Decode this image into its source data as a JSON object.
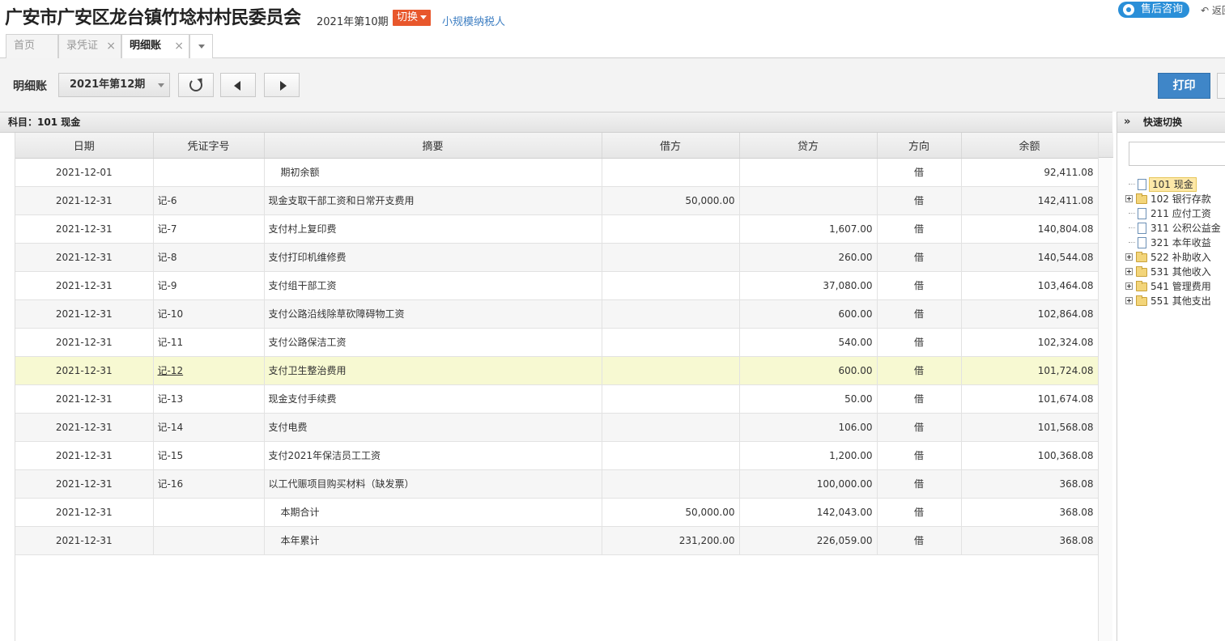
{
  "header": {
    "org_name": "广安市广安区龙台镇竹埝村村民委员会",
    "current_period": "2021年第10期",
    "switch_label": "切换",
    "taxpayer_type": "小规模纳税人",
    "consult_label": "售后咨询",
    "back_label": "↶ 返回"
  },
  "tabs": [
    {
      "label": "首页",
      "closable": false
    },
    {
      "label": "录凭证",
      "closable": true
    },
    {
      "label": "明细账",
      "closable": true,
      "active": true
    }
  ],
  "toolbar": {
    "title": "明细账",
    "period_value": "2021年第12期",
    "print_label": "打印"
  },
  "subject_bar": {
    "text": "科目：101  现金"
  },
  "table": {
    "columns": [
      "日期",
      "凭证字号",
      "摘要",
      "借方",
      "贷方",
      "方向",
      "余额"
    ],
    "rows": [
      {
        "date": "2021-12-01",
        "voucher": "",
        "summary": "期初余额",
        "debit": "",
        "credit": "",
        "dir": "借",
        "balance": "92,411.08",
        "indent": true
      },
      {
        "date": "2021-12-31",
        "voucher": "记-6",
        "summary": "现金支取干部工资和日常开支费用",
        "debit": "50,000.00",
        "credit": "",
        "dir": "借",
        "balance": "142,411.08"
      },
      {
        "date": "2021-12-31",
        "voucher": "记-7",
        "summary": "支付村上复印费",
        "debit": "",
        "credit": "1,607.00",
        "dir": "借",
        "balance": "140,804.08"
      },
      {
        "date": "2021-12-31",
        "voucher": "记-8",
        "summary": "支付打印机维修费",
        "debit": "",
        "credit": "260.00",
        "dir": "借",
        "balance": "140,544.08"
      },
      {
        "date": "2021-12-31",
        "voucher": "记-9",
        "summary": "支付组干部工资",
        "debit": "",
        "credit": "37,080.00",
        "dir": "借",
        "balance": "103,464.08"
      },
      {
        "date": "2021-12-31",
        "voucher": "记-10",
        "summary": "支付公路沿线除草砍障碍物工资",
        "debit": "",
        "credit": "600.00",
        "dir": "借",
        "balance": "102,864.08"
      },
      {
        "date": "2021-12-31",
        "voucher": "记-11",
        "summary": "支付公路保洁工资",
        "debit": "",
        "credit": "540.00",
        "dir": "借",
        "balance": "102,324.08"
      },
      {
        "date": "2021-12-31",
        "voucher": "记-12",
        "summary": "支付卫生整治费用",
        "debit": "",
        "credit": "600.00",
        "dir": "借",
        "balance": "101,724.08",
        "highlight": true
      },
      {
        "date": "2021-12-31",
        "voucher": "记-13",
        "summary": "现金支付手续费",
        "debit": "",
        "credit": "50.00",
        "dir": "借",
        "balance": "101,674.08"
      },
      {
        "date": "2021-12-31",
        "voucher": "记-14",
        "summary": "支付电费",
        "debit": "",
        "credit": "106.00",
        "dir": "借",
        "balance": "101,568.08"
      },
      {
        "date": "2021-12-31",
        "voucher": "记-15",
        "summary": "支付2021年保洁员工工资",
        "debit": "",
        "credit": "1,200.00",
        "dir": "借",
        "balance": "100,368.08"
      },
      {
        "date": "2021-12-31",
        "voucher": "记-16",
        "summary": "以工代赈项目购买材料（缺发票）",
        "debit": "",
        "credit": "100,000.00",
        "dir": "借",
        "balance": "368.08"
      },
      {
        "date": "2021-12-31",
        "voucher": "",
        "summary": "本期合计",
        "debit": "50,000.00",
        "credit": "142,043.00",
        "dir": "借",
        "balance": "368.08",
        "indent": true
      },
      {
        "date": "2021-12-31",
        "voucher": "",
        "summary": "本年累计",
        "debit": "231,200.00",
        "credit": "226,059.00",
        "dir": "借",
        "balance": "368.08",
        "indent": true
      }
    ]
  },
  "sidebar": {
    "chevron": "»",
    "title": "快速切换",
    "search_value": "",
    "tree": [
      {
        "label": "101 现金",
        "kind": "doc",
        "expandable": false,
        "selected": true
      },
      {
        "label": "102 银行存款",
        "kind": "folder",
        "expandable": true
      },
      {
        "label": "211 应付工资",
        "kind": "doc",
        "expandable": false
      },
      {
        "label": "311 公积公益金",
        "kind": "doc",
        "expandable": false
      },
      {
        "label": "321 本年收益",
        "kind": "doc",
        "expandable": false
      },
      {
        "label": "522 补助收入",
        "kind": "folder",
        "expandable": true
      },
      {
        "label": "531 其他收入",
        "kind": "folder",
        "expandable": true
      },
      {
        "label": "541 管理费用",
        "kind": "folder",
        "expandable": true
      },
      {
        "label": "551 其他支出",
        "kind": "folder",
        "expandable": true
      }
    ]
  },
  "colors": {
    "switch_bg": "#e8572c",
    "link": "#3d7ec2",
    "consult_bg": "#2a8fd8",
    "print_bg": "#3f86c8",
    "row_highlight": "#f7f9d2",
    "tree_selected": "#fde8a8"
  }
}
